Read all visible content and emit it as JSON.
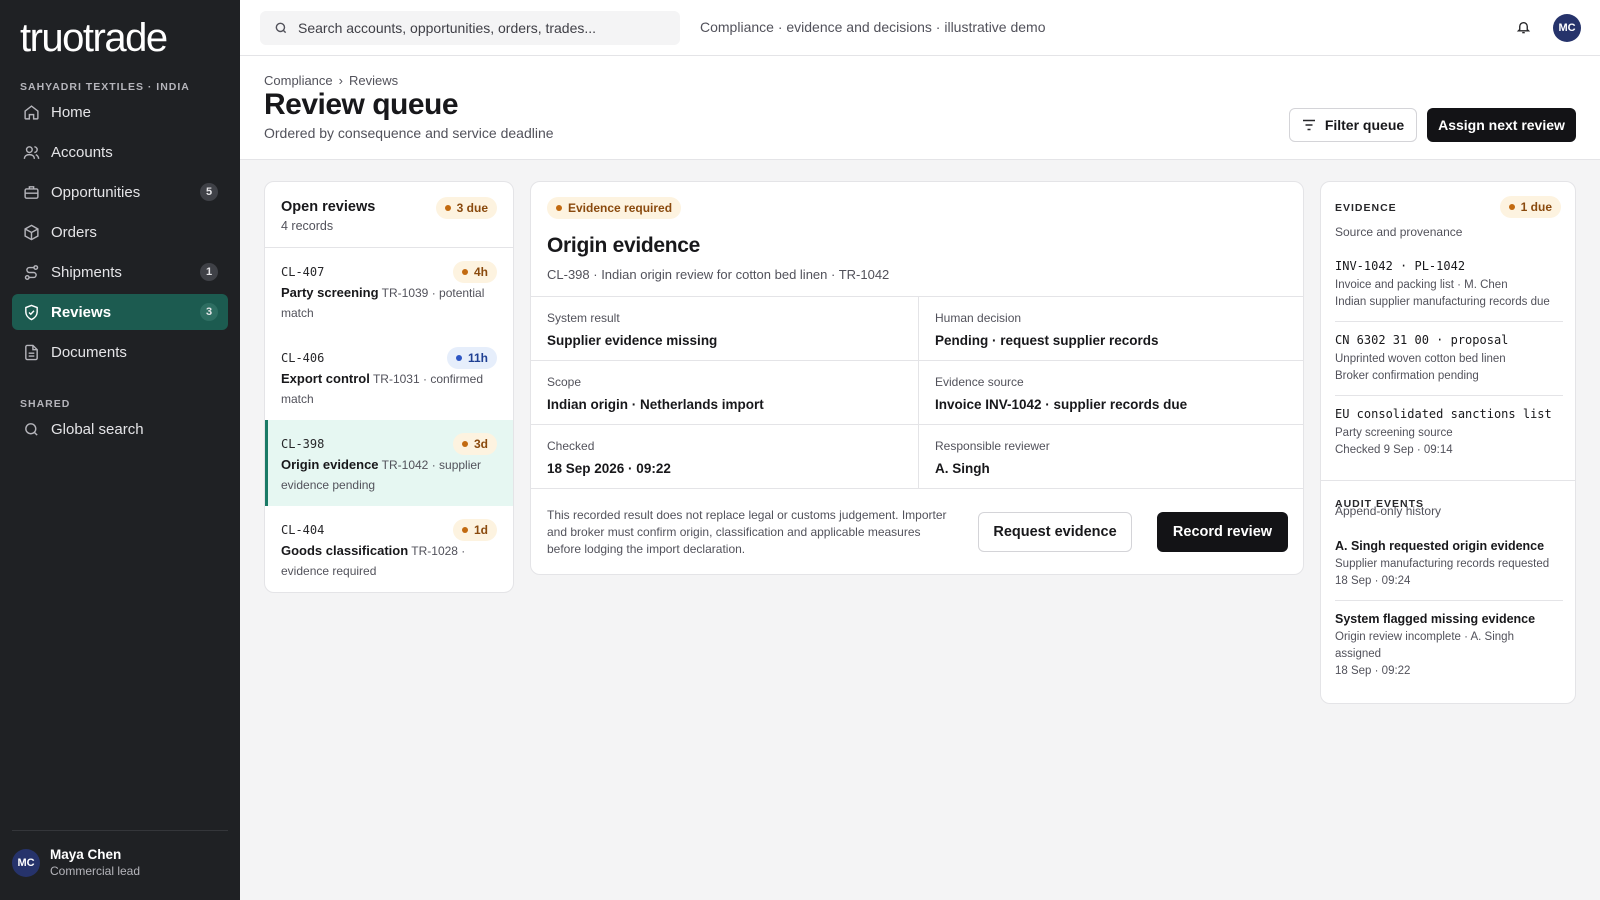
{
  "brand": {
    "logo": "truotrade",
    "org": "SAHYADRI TEXTILES · INDIA"
  },
  "sidebar": {
    "items": [
      {
        "label": "Home",
        "icon": "home-icon",
        "badge": ""
      },
      {
        "label": "Accounts",
        "icon": "users-icon",
        "badge": ""
      },
      {
        "label": "Opportunities",
        "icon": "briefcase-icon",
        "badge": "5"
      },
      {
        "label": "Orders",
        "icon": "box-icon",
        "badge": ""
      },
      {
        "label": "Shipments",
        "icon": "route-icon",
        "badge": "1"
      },
      {
        "label": "Reviews",
        "icon": "shield-check-icon",
        "badge": "3",
        "active": true
      },
      {
        "label": "Documents",
        "icon": "document-icon",
        "badge": ""
      }
    ],
    "shared_label": "SHARED",
    "shared_items": [
      {
        "label": "Global search",
        "icon": "search-icon"
      }
    ],
    "user": {
      "initials": "MC",
      "name": "Maya Chen",
      "role": "Commercial lead"
    }
  },
  "topbar": {
    "search_placeholder": "Search accounts, opportunities, orders, trades...",
    "note": "Compliance · evidence and decisions · illustrative demo",
    "avatar": "MC"
  },
  "header": {
    "breadcrumb": [
      "Compliance",
      "Reviews"
    ],
    "breadcrumb_sep": "›",
    "title": "Review queue",
    "subtitle": "Ordered by consequence and service deadline",
    "filter_label": "Filter queue",
    "assign_label": "Assign next review"
  },
  "queue": {
    "title": "Open reviews",
    "count": "4 records",
    "due": "3 due",
    "rows": [
      {
        "id": "CL-407",
        "badge": "4h",
        "tone": "amber",
        "title": "Party screening",
        "detail": "TR-1039 · potential match"
      },
      {
        "id": "CL-406",
        "badge": "11h",
        "tone": "blue",
        "title": "Export control",
        "detail": "TR-1031 · confirmed match"
      },
      {
        "id": "CL-398",
        "badge": "3d",
        "tone": "amber",
        "title": "Origin evidence",
        "detail": "TR-1042 · supplier evidence pending",
        "selected": true
      },
      {
        "id": "CL-404",
        "badge": "1d",
        "tone": "amber",
        "title": "Goods classification",
        "detail": "TR-1028 · evidence required"
      }
    ]
  },
  "detail": {
    "status": "Evidence required",
    "title": "Origin evidence",
    "subtitle": "CL-398 · Indian origin review for cotton bed linen · TR-1042",
    "fields": [
      {
        "label": "System result",
        "value": "Supplier evidence missing"
      },
      {
        "label": "Human decision",
        "value": "Pending · request supplier records"
      },
      {
        "label": "Scope",
        "value": "Indian origin · Netherlands import"
      },
      {
        "label": "Evidence source",
        "value": "Invoice INV-1042 · supplier records due"
      },
      {
        "label": "Checked",
        "value": "18 Sep 2026 · 09:22"
      },
      {
        "label": "Responsible reviewer",
        "value": "A. Singh"
      }
    ],
    "disclaimer": "This recorded result does not replace legal or customs judgement. Importer and broker must confirm origin, classification and applicable measures before lodging the import declaration.",
    "request_label": "Request evidence",
    "record_label": "Record review"
  },
  "evidence": {
    "caption": "EVIDENCE",
    "due": "1 due",
    "subtitle": "Source and provenance",
    "items": [
      {
        "code": "INV-1042 · PL-1042",
        "lines": [
          "Invoice and packing list · M. Chen",
          "Indian supplier manufacturing records due"
        ]
      },
      {
        "code": "CN 6302 31 00 · proposal",
        "lines": [
          "Unprinted woven cotton bed linen",
          "Broker confirmation pending"
        ]
      },
      {
        "code": "EU consolidated sanctions list",
        "lines": [
          "Party screening source",
          "Checked 9 Sep · 09:14"
        ]
      }
    ],
    "audit_caption": "AUDIT EVENTS",
    "audit_subtitle": "Append-only history",
    "audit": [
      {
        "title": "A. Singh requested origin evidence",
        "line": "Supplier manufacturing records requested",
        "time": "18 Sep · 09:24"
      },
      {
        "title": "System flagged missing evidence",
        "line": "Origin review incomplete · A. Singh assigned",
        "time": "18 Sep · 09:22"
      }
    ]
  },
  "colors": {
    "sidebar": "#1f2124",
    "active": "#1c5b50",
    "accent": "#1a7a66",
    "amber": "#c26a10",
    "blue": "#2c55c4"
  }
}
